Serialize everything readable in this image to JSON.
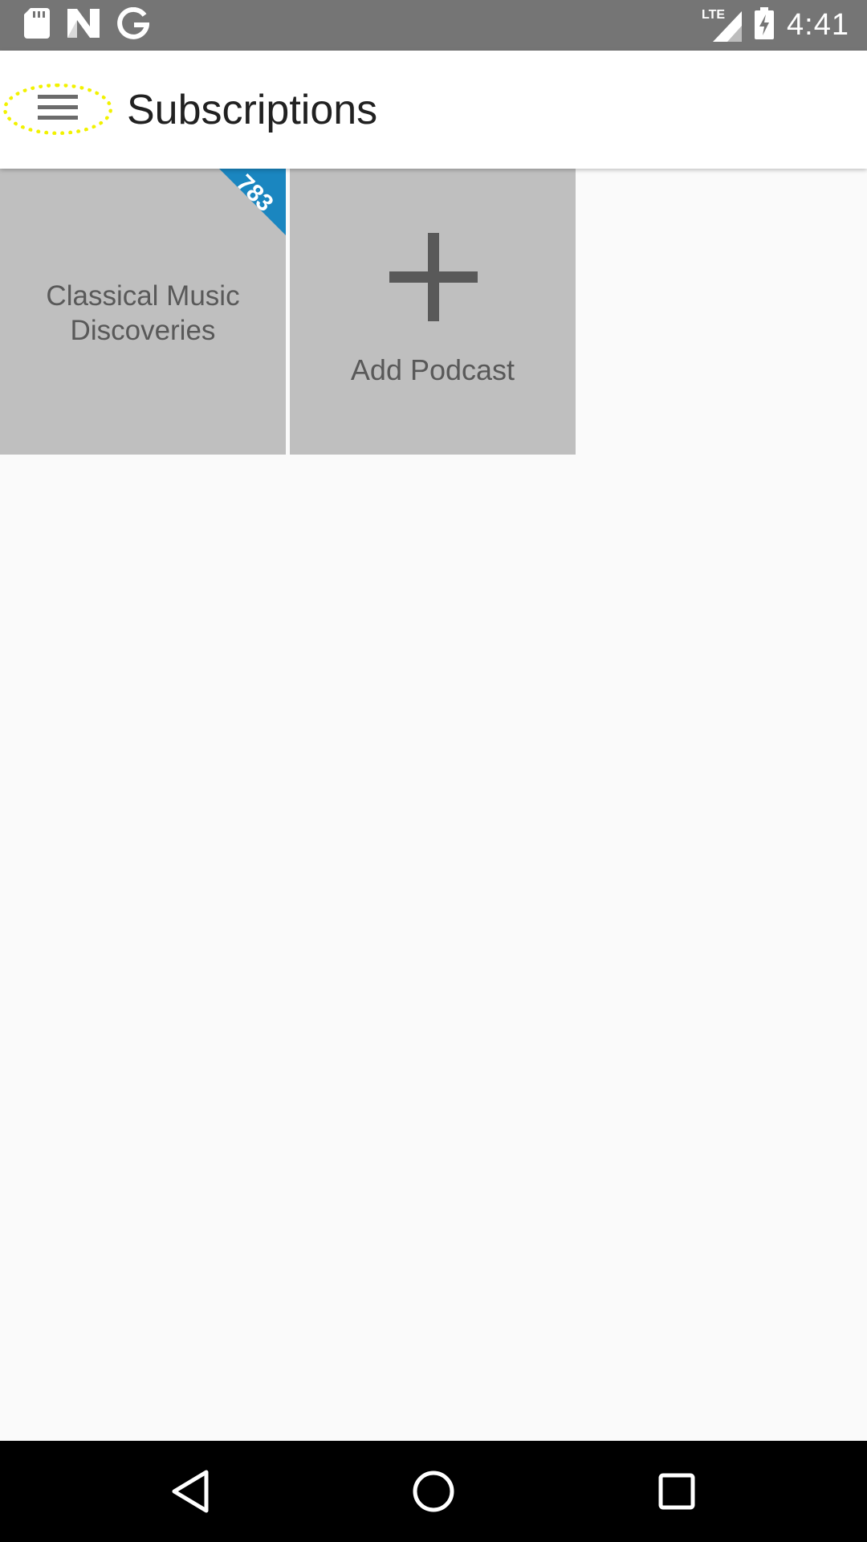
{
  "status_bar": {
    "time": "4:41",
    "network_label": "LTE",
    "left_icons": [
      "sd-card-icon",
      "n-logo-icon",
      "google-g-icon"
    ],
    "right_icons": [
      "lte-signal-icon",
      "battery-charging-icon"
    ]
  },
  "app_bar": {
    "title": "Subscriptions",
    "menu_icon": "hamburger-menu-icon",
    "menu_highlight_color": "#f2f200"
  },
  "subscriptions": [
    {
      "title": "Classical Music\nDiscoveries",
      "badge_count": "783",
      "badge_color": "#1a86c0"
    }
  ],
  "add_tile": {
    "label": "Add Podcast",
    "icon": "plus-icon"
  },
  "nav_bar": {
    "buttons": [
      "back-icon",
      "home-icon",
      "recents-icon"
    ]
  },
  "colors": {
    "status_bar": "#757575",
    "tile_background": "#bfbfbf",
    "tile_text": "#595959",
    "page_background": "#fafafa"
  }
}
